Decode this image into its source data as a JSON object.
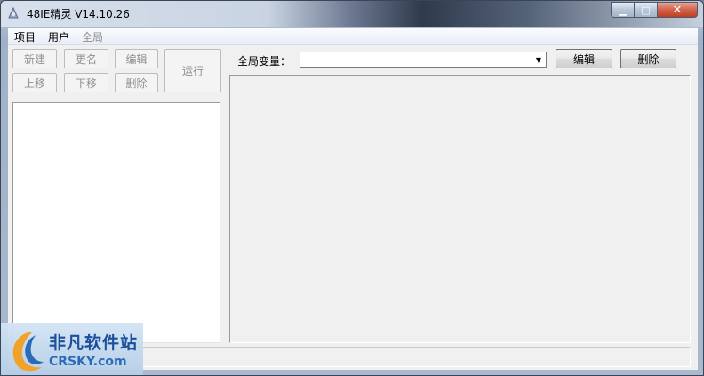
{
  "window": {
    "title": "48IE精灵 V14.10.26",
    "minimize_glyph": "▁",
    "maximize_glyph": "□",
    "close_glyph": "✕"
  },
  "menu": {
    "items": [
      {
        "label": "项目",
        "enabled": true
      },
      {
        "label": "用户",
        "enabled": true
      },
      {
        "label": "全局",
        "enabled": false
      }
    ]
  },
  "project_toolbar": {
    "new_label": "新建",
    "rename_label": "更名",
    "edit_label": "编辑",
    "move_up_label": "上移",
    "move_down_label": "下移",
    "delete_label": "删除",
    "run_label": "运行"
  },
  "global_vars": {
    "label": "全局变量：",
    "selected_value": "",
    "edit_label": "编辑",
    "delete_label": "删除",
    "dropdown_glyph": "▼"
  },
  "watermark": {
    "cn_text": "非凡软件站",
    "en_text": "CRSKY.com"
  },
  "colors": {
    "accent_blue": "#1e4f9c",
    "close_red": "#c0401f"
  }
}
